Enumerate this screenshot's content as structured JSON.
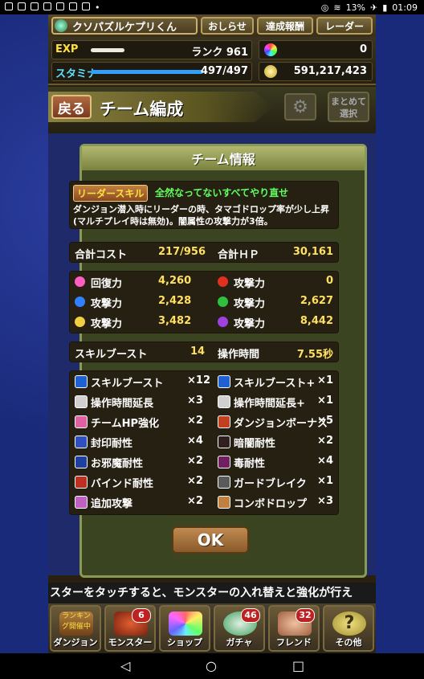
{
  "status": {
    "battery": "13%",
    "time": "01:09"
  },
  "header": {
    "player_name": "クソパズルケプリくん",
    "news_label": "おしらせ",
    "achievements_label": "達成報酬",
    "radar_label": "レーダー"
  },
  "stats": {
    "exp_label": "EXP",
    "rank": "ランク 961",
    "stamina_label": "スタミナ",
    "stamina": "497/497",
    "magic_stones": "0",
    "coins": "591,217,423",
    "exp_progress": 0.3,
    "stamina_progress": 1.0
  },
  "title": {
    "back_label": "戻る",
    "text": "チーム編成",
    "sort_label_1": "まとめて",
    "sort_label_2": "選択"
  },
  "panel": {
    "heading": "チーム情報",
    "leader_skill_badge": "リーダースキル",
    "leader_skill_name": "全然なってないすべてやり直せ",
    "leader_skill_desc_1": "ダンジョン潜入時にリーダーの時、タマゴドロップ率が少し上昇",
    "leader_skill_desc_2": "(マルチプレイ時は無効)。闇属性の攻撃力が3倍。",
    "cost_label": "合計コスト",
    "cost_value": "217/956",
    "hp_label": "合計ＨＰ",
    "hp_value": "30,161",
    "attrs": [
      {
        "label": "回復力",
        "value": "4,260",
        "color": "#ff60c0"
      },
      {
        "label": "攻撃力",
        "value": "0",
        "color": "#e03020"
      },
      {
        "label": "攻撃力",
        "value": "2,428",
        "color": "#3080ff"
      },
      {
        "label": "攻撃力",
        "value": "2,627",
        "color": "#30c040"
      },
      {
        "label": "攻撃力",
        "value": "3,482",
        "color": "#f0d040"
      },
      {
        "label": "攻撃力",
        "value": "8,442",
        "color": "#a040e0"
      }
    ],
    "skill_boost_label": "スキルブースト",
    "skill_boost_value": "14",
    "move_time_label": "操作時間",
    "move_time_value": "7.55秒",
    "awakenings": [
      {
        "label": "スキルブースト",
        "count": "×12",
        "color": "#2060d0"
      },
      {
        "label": "スキルブースト+",
        "count": "×1",
        "color": "#2060d0"
      },
      {
        "label": "操作時間延長",
        "count": "×3",
        "color": "#d0d0d0"
      },
      {
        "label": "操作時間延長+",
        "count": "×1",
        "color": "#d0d0d0"
      },
      {
        "label": "チームHP強化",
        "count": "×2",
        "color": "#e060a0"
      },
      {
        "label": "ダンジョンボーナス",
        "count": "×5",
        "color": "#c04020"
      },
      {
        "label": "封印耐性",
        "count": "×4",
        "color": "#3050c0"
      },
      {
        "label": "暗闇耐性",
        "count": "×2",
        "color": "#302020"
      },
      {
        "label": "お邪魔耐性",
        "count": "×2",
        "color": "#2040a0"
      },
      {
        "label": "毒耐性",
        "count": "×4",
        "color": "#702060"
      },
      {
        "label": "バインド耐性",
        "count": "×2",
        "color": "#c03020"
      },
      {
        "label": "ガードブレイク",
        "count": "×1",
        "color": "#5a5a5a"
      },
      {
        "label": "追加攻撃",
        "count": "×2",
        "color": "#c060c0"
      },
      {
        "label": "コンボドロップ",
        "count": "×3",
        "color": "#c08040"
      }
    ],
    "ok_label": "OK"
  },
  "ticker": "スターをタッチすると、モンスターの入れ替えと強化が行え",
  "menu": [
    {
      "label": "ダンジョン",
      "badge": "",
      "caption": "ランキング開催中"
    },
    {
      "label": "モンスター",
      "badge": "6",
      "caption": ""
    },
    {
      "label": "ショップ",
      "badge": "",
      "caption": ""
    },
    {
      "label": "ガチャ",
      "badge": "46",
      "caption": ""
    },
    {
      "label": "フレンド",
      "badge": "32",
      "caption": ""
    },
    {
      "label": "その他",
      "badge": "",
      "caption": ""
    }
  ]
}
